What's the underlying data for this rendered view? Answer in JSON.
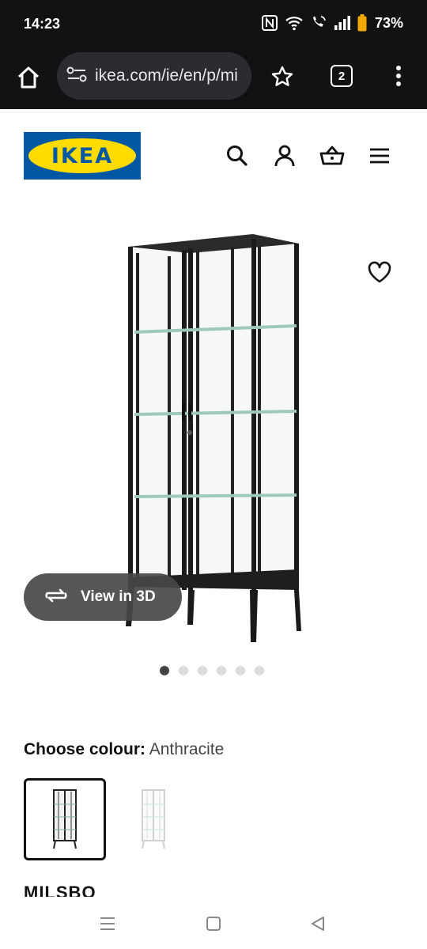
{
  "status_bar": {
    "time": "14:23",
    "battery": "73%",
    "icons": [
      "nfc-icon",
      "wifi-icon",
      "wifi-calling-icon",
      "signal-icon",
      "battery-icon"
    ]
  },
  "browser": {
    "url": "ikea.com/ie/en/p/mi",
    "tab_count": "2",
    "icons": [
      "home-icon",
      "site-settings-icon",
      "star-icon",
      "tabs-icon",
      "more-vert-icon"
    ]
  },
  "site_header": {
    "logo_text": "IKEA",
    "icons": [
      "search-icon",
      "account-icon",
      "basket-icon",
      "menu-icon"
    ]
  },
  "product": {
    "view_3d_label": "View in 3D",
    "image_count": 6,
    "active_image_index": 0,
    "colour_label": "Choose colour:",
    "colour_value": "Anthracite",
    "swatches": [
      "Anthracite",
      "White"
    ],
    "name": "MILSBO"
  },
  "nav_bar": {
    "icons": [
      "recent-apps-icon",
      "home-nav-icon",
      "back-icon"
    ]
  },
  "colors": {
    "ikea_blue": "#0058a3",
    "ikea_yellow": "#ffdb00",
    "bar_dark": "#111214"
  }
}
